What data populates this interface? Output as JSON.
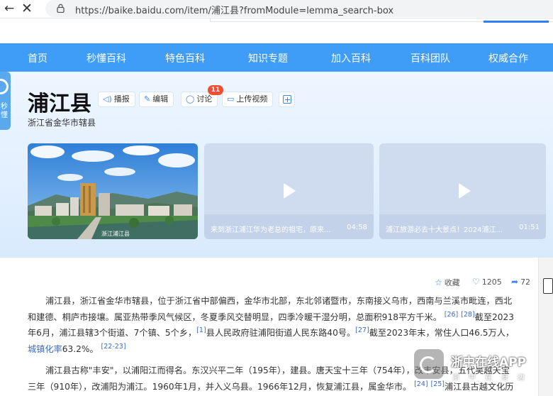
{
  "browser": {
    "back_glyph": "←",
    "close_glyph": "✕",
    "url": "https://baike.baidu.com/item/浦江县?fromModule=lemma_search-box"
  },
  "nav": {
    "items": [
      "首页",
      "秒懂百科",
      "特色百科",
      "知识专题",
      "加入百科",
      "百科团队",
      "权威合作"
    ]
  },
  "side_tab": {
    "label": "秒懂"
  },
  "lemma": {
    "title": "浦江县",
    "subtitle": "浙江省金华市辖县",
    "tools": {
      "broadcast": "播报",
      "edit": "编辑",
      "discuss": "讨论",
      "discuss_count": "11",
      "upload_video": "上传视频"
    }
  },
  "media": {
    "photo_caption": "浙江浦江县",
    "videos": [
      {
        "caption": "来到浙江浦江华为老总的祖宅，原来...",
        "duration": "04:58"
      },
      {
        "caption": "浦江旅游必去十大景点！2024浦江...",
        "duration": "01:51"
      }
    ]
  },
  "actions": {
    "collect": "收藏",
    "like_count": "1205",
    "share_count": "72"
  },
  "article": {
    "p1": {
      "l1": "浦江县，浙江省金华市辖县，位于浙江省中部偏西，金华市北部，东北邻诸暨市，东南接义乌市，西南与兰溪市毗连，西北",
      "l2a": "和建德、桐庐市接壤。属亚热带季风气候区，冬夏季风交替明显，四季冷暖干湿分明，总面积918平方千米。",
      "ref26": "[26]",
      "ref28": "[28]",
      "l2b": "截至2023",
      "l3a": "年6月，浦江县辖3个街道、7个镇、5个乡，",
      "ref1": "[1]",
      "l3b": "县人民政府驻浦阳街道人民东路40号。",
      "ref27": "[27]",
      "l3c": "截至2023年末，常住人口46.5万人，",
      "l4link": "城镇化率",
      "l4a": "63.2%。",
      "ref2223": "[22-23]"
    },
    "p2": {
      "l1": "浦江县古称\"丰安\"，以浦阳江而得名。东汉兴平二年（195年），建县。唐天宝十三年（754年），改丰安县，五代吴越天宝",
      "l2": "三年（910年），改浦阳为浦江。1960年1月，并入义乌县。1966年12月，恢复浦江县，属金华市。",
      "ref24": "[24]",
      "ref25": "[25]",
      "l2b": "浦江县古越文化历"
    }
  },
  "watermark": {
    "title": "浙中在线APP",
    "sub": "浙中在身边"
  },
  "colors": {
    "nav_bg": "#3f9df7",
    "accent": "#3b86e9",
    "badge": "#f04e33",
    "link": "#3b6cc8"
  }
}
